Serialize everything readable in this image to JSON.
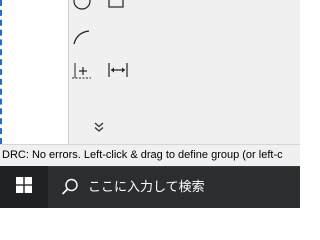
{
  "toolbar": {
    "tools": [
      {
        "icon": "circle-icon"
      },
      {
        "icon": "rectangle-icon"
      },
      {
        "icon": "curve-icon"
      },
      {
        "icon": "anchor-point-icon"
      },
      {
        "icon": "dimension-icon"
      },
      {
        "icon": "chevron-double-down-icon"
      }
    ]
  },
  "status_bar": {
    "text": "DRC: No errors. Left-click & drag to define group (or left-c"
  },
  "taskbar": {
    "search_placeholder": "ここに入力して検索"
  }
}
